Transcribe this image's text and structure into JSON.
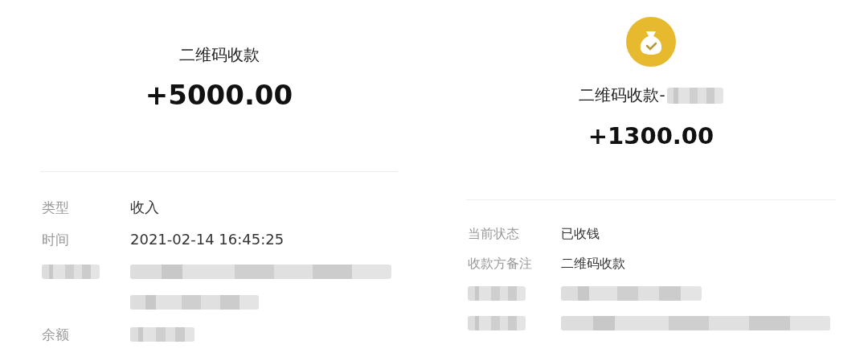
{
  "panels": [
    {
      "kind": "plain",
      "title": "二维码收款",
      "amount": "+5000.00",
      "rows": [
        {
          "kind": "text",
          "label": "类型",
          "value": "收入"
        },
        {
          "kind": "text",
          "label": "时间",
          "value": "2021-02-14 16:45:25"
        },
        {
          "kind": "redacted_wrap"
        },
        {
          "kind": "value_redacted",
          "label": "余额"
        }
      ]
    },
    {
      "kind": "icon_redacted_title",
      "title": "二维码收款-",
      "amount": "+1300.00",
      "rows": [
        {
          "kind": "text",
          "label": "当前状态",
          "value": "已收钱"
        },
        {
          "kind": "text",
          "label": "收款方备注",
          "value": "二维码收款"
        },
        {
          "kind": "redacted_medium"
        },
        {
          "kind": "redacted_long"
        }
      ]
    }
  ]
}
